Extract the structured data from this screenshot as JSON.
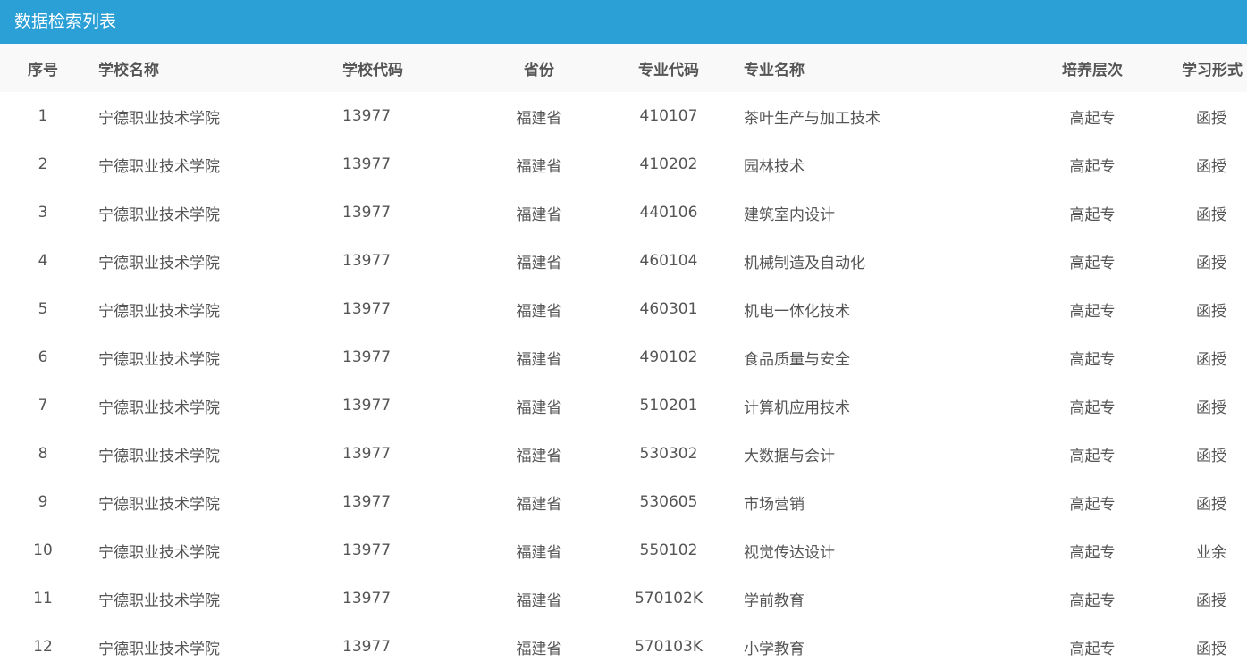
{
  "panel": {
    "title": "数据检索列表"
  },
  "table": {
    "headers": {
      "index": "序号",
      "school_name": "学校名称",
      "school_code": "学校代码",
      "province": "省份",
      "major_code": "专业代码",
      "major_name": "专业名称",
      "level": "培养层次",
      "study_form": "学习形式"
    },
    "rows": [
      {
        "index": "1",
        "school_name": "宁德职业技术学院",
        "school_code": "13977",
        "province": "福建省",
        "major_code": "410107",
        "major_name": "茶叶生产与加工技术",
        "level": "高起专",
        "study_form": "函授"
      },
      {
        "index": "2",
        "school_name": "宁德职业技术学院",
        "school_code": "13977",
        "province": "福建省",
        "major_code": "410202",
        "major_name": "园林技术",
        "level": "高起专",
        "study_form": "函授"
      },
      {
        "index": "3",
        "school_name": "宁德职业技术学院",
        "school_code": "13977",
        "province": "福建省",
        "major_code": "440106",
        "major_name": "建筑室内设计",
        "level": "高起专",
        "study_form": "函授"
      },
      {
        "index": "4",
        "school_name": "宁德职业技术学院",
        "school_code": "13977",
        "province": "福建省",
        "major_code": "460104",
        "major_name": "机械制造及自动化",
        "level": "高起专",
        "study_form": "函授"
      },
      {
        "index": "5",
        "school_name": "宁德职业技术学院",
        "school_code": "13977",
        "province": "福建省",
        "major_code": "460301",
        "major_name": "机电一体化技术",
        "level": "高起专",
        "study_form": "函授"
      },
      {
        "index": "6",
        "school_name": "宁德职业技术学院",
        "school_code": "13977",
        "province": "福建省",
        "major_code": "490102",
        "major_name": "食品质量与安全",
        "level": "高起专",
        "study_form": "函授"
      },
      {
        "index": "7",
        "school_name": "宁德职业技术学院",
        "school_code": "13977",
        "province": "福建省",
        "major_code": "510201",
        "major_name": "计算机应用技术",
        "level": "高起专",
        "study_form": "函授"
      },
      {
        "index": "8",
        "school_name": "宁德职业技术学院",
        "school_code": "13977",
        "province": "福建省",
        "major_code": "530302",
        "major_name": "大数据与会计",
        "level": "高起专",
        "study_form": "函授"
      },
      {
        "index": "9",
        "school_name": "宁德职业技术学院",
        "school_code": "13977",
        "province": "福建省",
        "major_code": "530605",
        "major_name": "市场营销",
        "level": "高起专",
        "study_form": "函授"
      },
      {
        "index": "10",
        "school_name": "宁德职业技术学院",
        "school_code": "13977",
        "province": "福建省",
        "major_code": "550102",
        "major_name": "视觉传达设计",
        "level": "高起专",
        "study_form": "业余"
      },
      {
        "index": "11",
        "school_name": "宁德职业技术学院",
        "school_code": "13977",
        "province": "福建省",
        "major_code": "570102K",
        "major_name": "学前教育",
        "level": "高起专",
        "study_form": "函授"
      },
      {
        "index": "12",
        "school_name": "宁德职业技术学院",
        "school_code": "13977",
        "province": "福建省",
        "major_code": "570103K",
        "major_name": "小学教育",
        "level": "高起专",
        "study_form": "函授"
      }
    ]
  },
  "colors": {
    "header_bar": "#2aa0d6",
    "table_head_bg": "#f9f9f9",
    "text": "#555555"
  }
}
